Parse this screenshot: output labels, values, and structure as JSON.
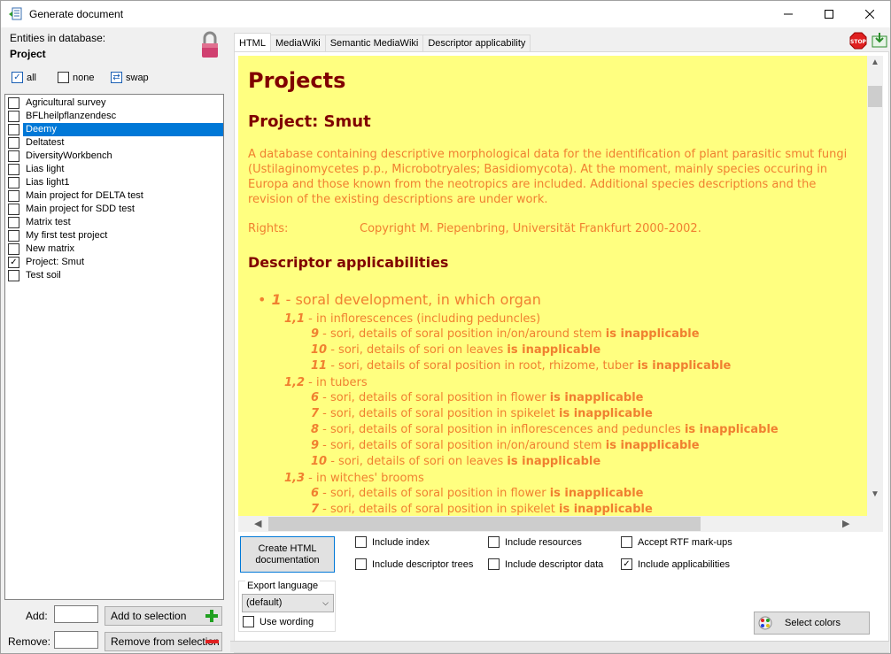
{
  "window": {
    "title": "Generate document"
  },
  "left": {
    "entities_label": "Entities in database:",
    "entity_name": "Project",
    "all_label": "all",
    "none_label": "none",
    "swap_label": "swap",
    "items": [
      {
        "label": "Agricultural survey",
        "checked": false,
        "selected": false
      },
      {
        "label": "BFLheilpflanzendesc",
        "checked": false,
        "selected": false
      },
      {
        "label": "Deemy",
        "checked": false,
        "selected": true
      },
      {
        "label": "Deltatest",
        "checked": false,
        "selected": false
      },
      {
        "label": "DiversityWorkbench",
        "checked": false,
        "selected": false
      },
      {
        "label": "Lias light",
        "checked": false,
        "selected": false
      },
      {
        "label": "Lias light1",
        "checked": false,
        "selected": false
      },
      {
        "label": "Main project for DELTA test",
        "checked": false,
        "selected": false
      },
      {
        "label": "Main project for SDD test",
        "checked": false,
        "selected": false
      },
      {
        "label": "Matrix test",
        "checked": false,
        "selected": false
      },
      {
        "label": "My first test project",
        "checked": false,
        "selected": false
      },
      {
        "label": "New matrix",
        "checked": false,
        "selected": false
      },
      {
        "label": "Project: Smut",
        "checked": true,
        "selected": false
      },
      {
        "label": "Test soil",
        "checked": false,
        "selected": false
      }
    ],
    "add_label": "Add:",
    "remove_label": "Remove:",
    "add_button": "Add to selection",
    "remove_button": "Remove from selection",
    "add_value": "",
    "remove_value": ""
  },
  "tabs": [
    {
      "label": "HTML",
      "active": true
    },
    {
      "label": "MediaWiki",
      "active": false
    },
    {
      "label": "Semantic MediaWiki",
      "active": false
    },
    {
      "label": "Descriptor applicability",
      "active": false
    }
  ],
  "doc": {
    "h1": "Projects",
    "h2": "Project: Smut",
    "description": "A database containing descriptive morphological data for the identification of plant parasitic smut fungi (Ustilaginomycetes p.p., Microbotryales; Basidiomycota). At the moment, mainly species occuring in Europa and those known from the neotropics are included. Additional species descriptions and the revision of the existing descriptions are under work.",
    "rights_label": "Rights:",
    "rights_value": "Copyright M. Piepenbring, Universität Frankfurt 2000-2002.",
    "h3": "Descriptor applicabilities",
    "tree": [
      {
        "level": 1,
        "num": "1",
        "text": " - soral development, in which organ",
        "suffix": ""
      },
      {
        "level": 2,
        "num": "1,1",
        "text": " - in inflorescences (including peduncles)",
        "suffix": ""
      },
      {
        "level": 3,
        "num": "9",
        "text": " - sori, details of soral position in/on/around stem ",
        "suffix": "is inapplicable"
      },
      {
        "level": 3,
        "num": "10",
        "text": " - sori, details of sori on leaves ",
        "suffix": "is inapplicable"
      },
      {
        "level": 3,
        "num": "11",
        "text": " - sori, details of soral position in root, rhizome, tuber ",
        "suffix": "is inapplicable"
      },
      {
        "level": 2,
        "num": "1,2",
        "text": " - in tubers",
        "suffix": ""
      },
      {
        "level": 3,
        "num": "6",
        "text": " - sori, details of soral position in flower ",
        "suffix": "is inapplicable"
      },
      {
        "level": 3,
        "num": "7",
        "text": " - sori, details of soral position in spikelet ",
        "suffix": "is inapplicable"
      },
      {
        "level": 3,
        "num": "8",
        "text": " - sori, details of soral position in inflorescences and peduncles ",
        "suffix": "is inapplicable"
      },
      {
        "level": 3,
        "num": "9",
        "text": " - sori, details of soral position in/on/around stem ",
        "suffix": "is inapplicable"
      },
      {
        "level": 3,
        "num": "10",
        "text": " - sori, details of sori on leaves ",
        "suffix": "is inapplicable"
      },
      {
        "level": 2,
        "num": "1,3",
        "text": " - in witches' brooms",
        "suffix": ""
      },
      {
        "level": 3,
        "num": "6",
        "text": " - sori, details of soral position in flower ",
        "suffix": "is inapplicable"
      },
      {
        "level": 3,
        "num": "7",
        "text": " - sori, details of soral position in spikelet ",
        "suffix": "is inapplicable"
      }
    ]
  },
  "options": {
    "create_button": "Create HTML documentation",
    "include_index": "Include index",
    "include_descriptor_trees": "Include descriptor trees",
    "include_resources": "Include resources",
    "include_descriptor_data": "Include descriptor data",
    "accept_rtf": "Accept RTF mark-ups",
    "include_applicabilities": "Include applicabilities",
    "export_language_label": "Export language",
    "export_language_value": "(default)",
    "use_wording": "Use wording",
    "select_colors": "Select colors"
  },
  "colors": {
    "doc_background": "#ffff80",
    "heading": "#800000",
    "body_text": "#f08030",
    "selection": "#0078d7"
  }
}
